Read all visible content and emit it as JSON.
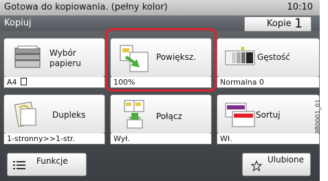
{
  "status": {
    "message": "Gotowa do kopiowania. (pełny kolor)",
    "time": "10:10"
  },
  "header": {
    "title": "Kopiuj",
    "copies_label": "Kopie",
    "copies_value": "1"
  },
  "tiles": [
    {
      "name": "paper-select",
      "label": "Wybór papieru",
      "value": "A4",
      "icon": "paper-tray-icon"
    },
    {
      "name": "zoom",
      "label": "Powiększ.",
      "value": "100%",
      "icon": "zoom-icon",
      "selected": true
    },
    {
      "name": "density",
      "label": "Gęstość",
      "value": "Normalna 0",
      "icon": "density-icon"
    },
    {
      "name": "duplex",
      "label": "Dupleks",
      "value": "1-stronny>>1-str.",
      "icon": "duplex-icon"
    },
    {
      "name": "combine",
      "label": "Połącz",
      "value": "Wył.",
      "icon": "combine-icon"
    },
    {
      "name": "collate",
      "label": "Sortuj",
      "value": "Wł.",
      "icon": "collate-icon"
    }
  ],
  "bottom": {
    "functions_label": "Funkcje",
    "favorites_label": "Ulubione"
  },
  "side_code": "3B0001_01",
  "colors": {
    "accent_purple": "#7a2b8c",
    "selection_red": "#e0222a",
    "arrow_green": "#4caf3c"
  }
}
